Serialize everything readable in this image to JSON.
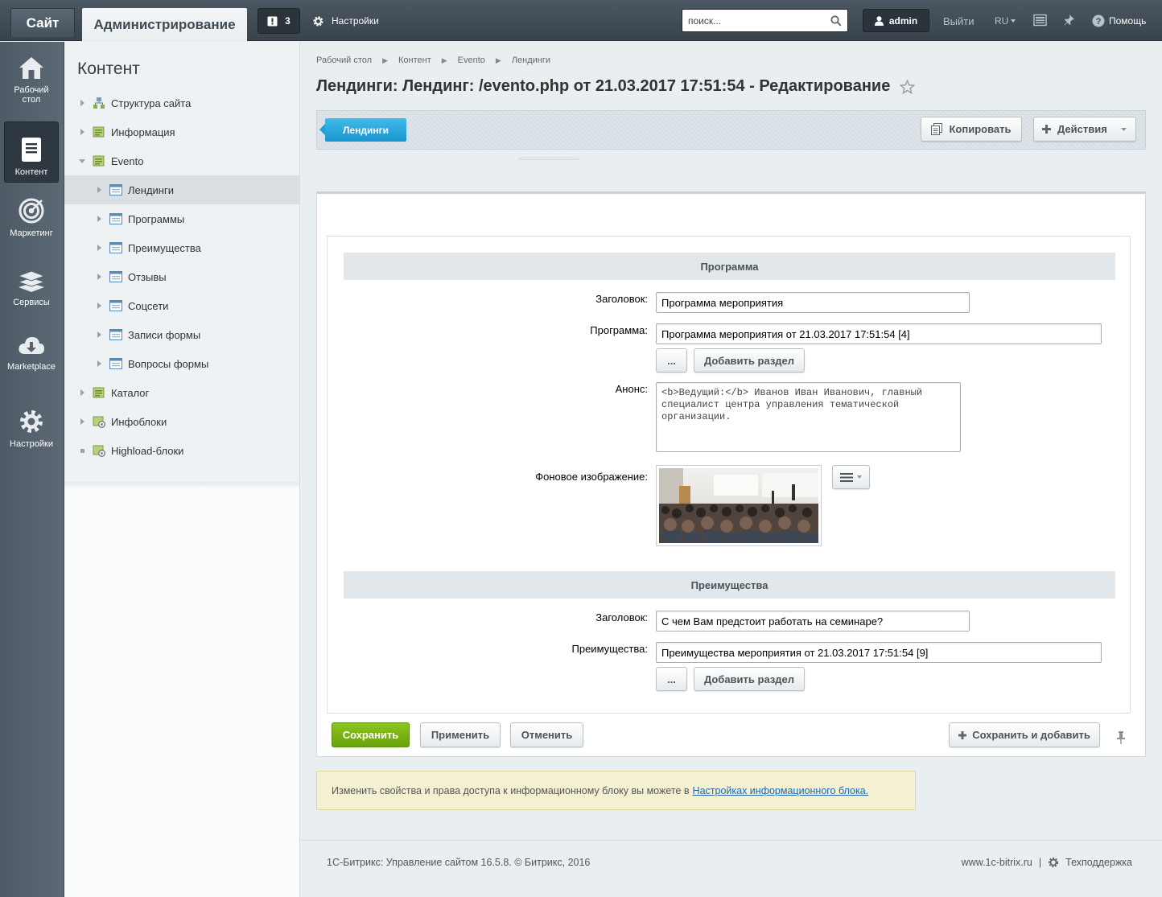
{
  "topbar": {
    "site_tab": "Сайт",
    "admin_tab": "Администрирование",
    "notifications_count": "3",
    "settings": "Настройки",
    "search_placeholder": "поиск...",
    "user": "admin",
    "logout": "Выйти",
    "lang": "RU",
    "help": "Помощь"
  },
  "leftnav": [
    {
      "label": "Рабочий стол",
      "icon": "home-icon"
    },
    {
      "label": "Контент",
      "icon": "document-icon",
      "active": true
    },
    {
      "label": "Маркетинг",
      "icon": "target-icon"
    },
    {
      "label": "Сервисы",
      "icon": "layers-icon"
    },
    {
      "label": "Marketplace",
      "icon": "cloud-download-icon"
    },
    {
      "label": "Настройки",
      "icon": "gear-icon"
    }
  ],
  "sidebar": {
    "title": "Контент",
    "items": [
      {
        "label": "Структура сайта"
      },
      {
        "label": "Информация"
      },
      {
        "label": "Evento"
      },
      {
        "label": "Лендинги"
      },
      {
        "label": "Программы"
      },
      {
        "label": "Преимущества"
      },
      {
        "label": "Отзывы"
      },
      {
        "label": "Соцсети"
      },
      {
        "label": "Записи формы"
      },
      {
        "label": "Вопросы формы"
      },
      {
        "label": "Каталог"
      },
      {
        "label": "Инфоблоки"
      },
      {
        "label": "Highload-блоки"
      }
    ]
  },
  "breadcrumb": [
    "Рабочий стол",
    "Контент",
    "Evento",
    "Лендинги"
  ],
  "page_title": "Лендинги: Лендинг: /evento.php от 21.03.2017 17:51:54 - Редактирование",
  "toolbar": {
    "list_button": "Лендинги",
    "copy_button": "Копировать",
    "actions_button": "Действия"
  },
  "form": {
    "section1": {
      "title": "Программа",
      "heading_label": "Заголовок:",
      "heading_value": "Программа мероприятия",
      "program_label": "Программа:",
      "program_value": "Программа мероприятия от 21.03.2017 17:51:54 [4]",
      "browse_button": "...",
      "add_section_button": "Добавить раздел",
      "announce_label": "Анонс:",
      "announce_value": "<b>Ведущий:</b> Иванов Иван Иванович, главный специалист центра управления тематической организации.",
      "bg_image_label": "Фоновое изображение:"
    },
    "section2": {
      "title": "Преимущества",
      "heading_label": "Заголовок:",
      "heading_value": "С чем Вам предстоит работать на семинаре?",
      "advantages_label": "Преимущества:",
      "advantages_value": "Преимущества мероприятия от 21.03.2017 17:51:54 [9]",
      "browse_button": "...",
      "add_section_button": "Добавить раздел"
    }
  },
  "buttons": {
    "save": "Сохранить",
    "apply": "Применить",
    "cancel": "Отменить",
    "save_and_add": "Сохранить и добавить"
  },
  "note": {
    "text": "Изменить свойства и права доступа к информационному блоку вы можете в",
    "link": "Настройках информационного блока."
  },
  "footer": {
    "copyright": "1С-Битрикс: Управление сайтом 16.5.8. © Битрикс, 2016",
    "site": "www.1c-bitrix.ru",
    "separator": "|",
    "support": "Техподдержка"
  },
  "colors": {
    "accent_blue": "#1a95cf",
    "save_green": "#68a30b",
    "link": "#2067b0"
  }
}
